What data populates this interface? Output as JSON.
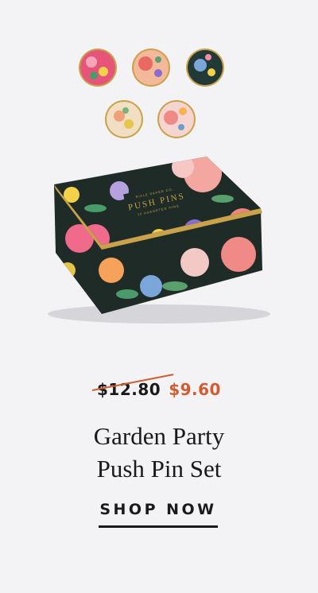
{
  "product": {
    "price_original": "$12.80",
    "price_sale": "$9.60",
    "title_line1": "Garden Party",
    "title_line2": "Push Pin Set",
    "tin_brand": "RIFLE PAPER CO.",
    "tin_label": "PUSH PINS",
    "tin_subtext": "10 ASSORTED PINS"
  },
  "cta": {
    "label": "SHOP NOW"
  },
  "colors": {
    "background": "#f3f3f5",
    "sale_accent": "#d45a2f",
    "text": "#1a1a1a",
    "tin_dark": "#1f2b26",
    "tin_gold": "#c9a24a"
  }
}
